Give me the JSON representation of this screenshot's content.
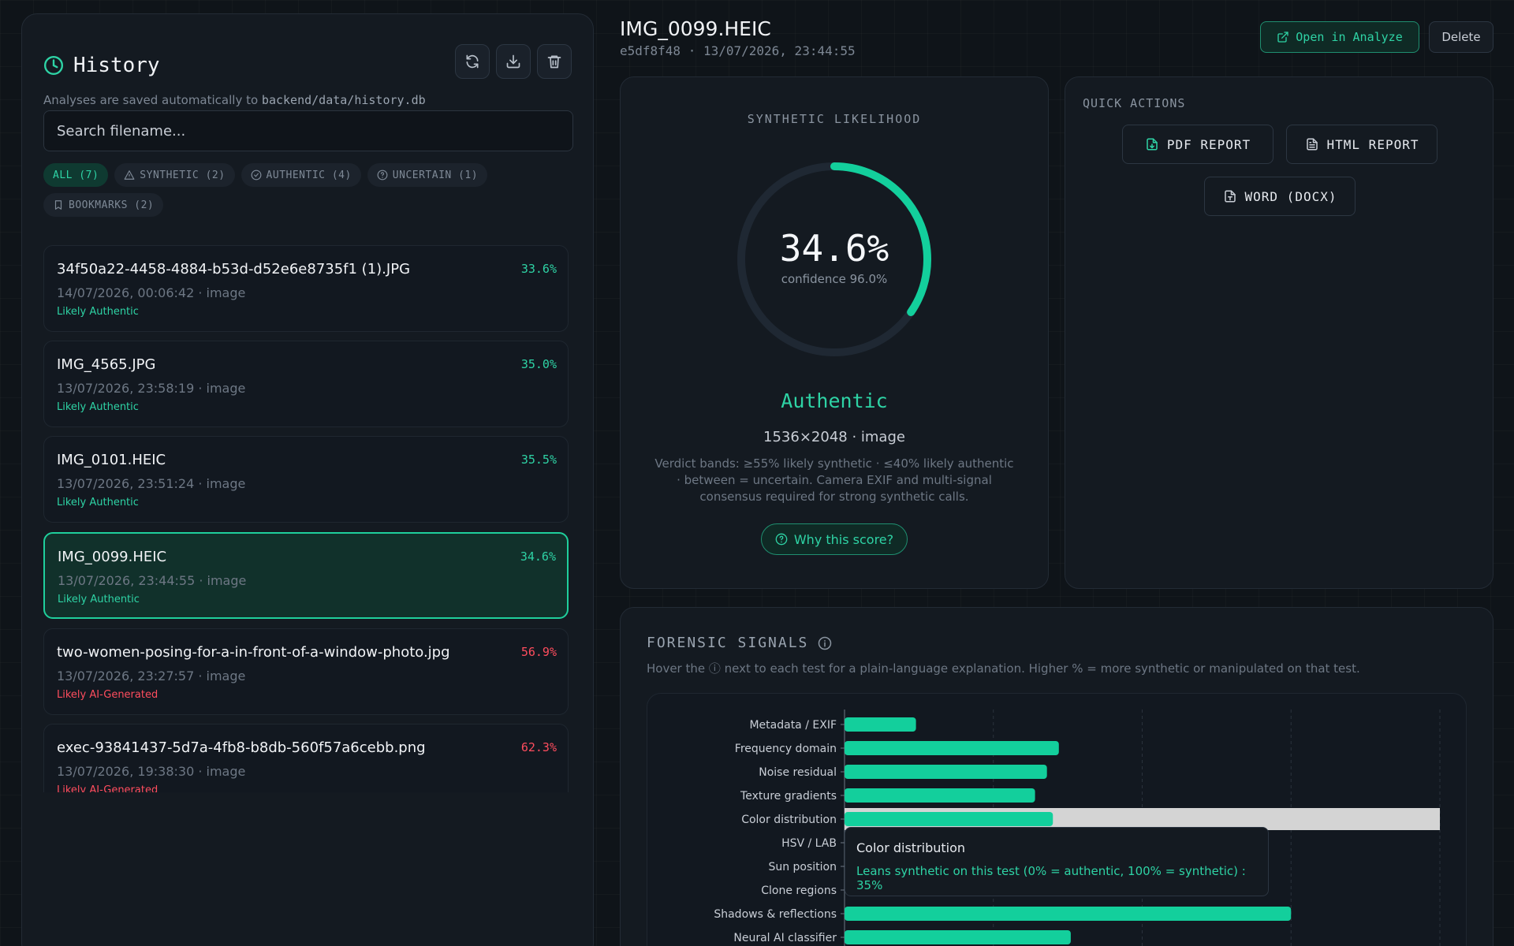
{
  "colors": {
    "accent": "#2ed3a5",
    "authentic": "#2ed3a5",
    "synthetic": "#ff4d5e",
    "bar": "#13cf9c",
    "hover_band": "#d4d4d4"
  },
  "history": {
    "title": "History",
    "subtitle_prefix": "Analyses are saved automatically to ",
    "subtitle_path": "backend/data/history.db",
    "tools": [
      {
        "icon": "refresh-icon"
      },
      {
        "icon": "download-icon"
      },
      {
        "icon": "trash-icon"
      }
    ],
    "search_placeholder": "Search filename...",
    "filters": [
      {
        "label": "ALL (7)",
        "icon": "",
        "active": true
      },
      {
        "label": "SYNTHETIC (2)",
        "icon": "warning-icon",
        "active": false
      },
      {
        "label": "AUTHENTIC (4)",
        "icon": "check-circle-icon",
        "active": false
      },
      {
        "label": "UNCERTAIN (1)",
        "icon": "question-circle-icon",
        "active": false
      },
      {
        "label": "BOOKMARKS (2)",
        "icon": "bookmark-icon",
        "active": false
      }
    ],
    "items": [
      {
        "name": "34f50a22-4458-4884-b53d-d52e6e8735f1 (1).JPG",
        "meta": "14/07/2026, 00:06:42 · image",
        "verdict": "Likely Authentic",
        "pct": "33.6%",
        "kind": "authentic",
        "selected": false
      },
      {
        "name": "IMG_4565.JPG",
        "meta": "13/07/2026, 23:58:19 · image",
        "verdict": "Likely Authentic",
        "pct": "35.0%",
        "kind": "authentic",
        "selected": false
      },
      {
        "name": "IMG_0101.HEIC",
        "meta": "13/07/2026, 23:51:24 · image",
        "verdict": "Likely Authentic",
        "pct": "35.5%",
        "kind": "authentic",
        "selected": false
      },
      {
        "name": "IMG_0099.HEIC",
        "meta": "13/07/2026, 23:44:55 · image",
        "verdict": "Likely Authentic",
        "pct": "34.6%",
        "kind": "authentic",
        "selected": true
      },
      {
        "name": "two-women-posing-for-a-in-front-of-a-window-photo.jpg",
        "meta": "13/07/2026, 23:27:57 · image",
        "verdict": "Likely AI-Generated",
        "pct": "56.9%",
        "kind": "synthetic",
        "selected": false
      },
      {
        "name": "exec-93841437-5d7a-4fb8-b8db-560f57a6cebb.png",
        "meta": "13/07/2026, 19:38:30 · image",
        "verdict": "Likely AI-Generated",
        "pct": "62.3%",
        "kind": "synthetic",
        "selected": false
      }
    ]
  },
  "detail": {
    "filename": "IMG_0099.HEIC",
    "meta": "e5df8f48 · 13/07/2026, 23:44:55",
    "open_label": "Open in Analyze",
    "delete_label": "Delete"
  },
  "score": {
    "label": "SYNTHETIC LIKELIHOOD",
    "value": "34.6%",
    "fraction": 0.346,
    "confidence": "confidence 96.0%",
    "verdict": "Authentic",
    "dims": "1536×2048 · image",
    "bands_text": "Verdict bands: ≥55% likely synthetic · ≤40% likely authentic · between = uncertain. Camera EXIF and multi-signal consensus required for strong synthetic calls.",
    "why_label": "Why this score?"
  },
  "quick_actions": {
    "label": "QUICK ACTIONS",
    "pdf": "PDF REPORT",
    "html": "HTML REPORT",
    "word": "WORD (DOCX)"
  },
  "signals": {
    "title": "FORENSIC SIGNALS",
    "subtitle": "Hover the ⓘ next to each test for a plain-language explanation. Higher % = more synthetic or manipulated on that test.",
    "tooltip_title": "Color distribution",
    "tooltip_text": "Leans synthetic on this test (0% = authentic, 100% = synthetic) : 35%"
  },
  "chart_data": {
    "type": "bar",
    "orientation": "horizontal",
    "categories": [
      "Metadata / EXIF",
      "Frequency domain",
      "Noise residual",
      "Texture gradients",
      "Color distribution",
      "HSV / LAB",
      "Sun position",
      "Clone regions",
      "Shadows & reflections",
      "Neural AI classifier"
    ],
    "values": [
      12,
      36,
      34,
      32,
      35,
      null,
      null,
      null,
      75,
      38
    ],
    "xlim": [
      0,
      100
    ],
    "grid": true,
    "hovered": "Color distribution"
  }
}
